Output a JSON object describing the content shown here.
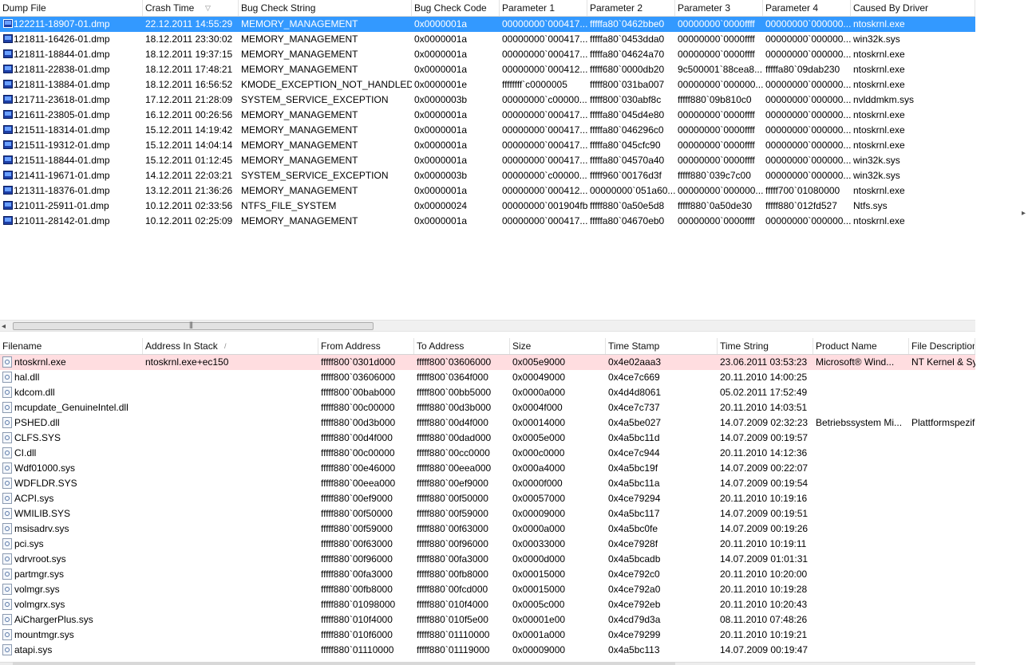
{
  "crash_list": {
    "columns": [
      "Dump File",
      "Crash Time",
      "Bug Check String",
      "Bug Check Code",
      "Parameter 1",
      "Parameter 2",
      "Parameter 3",
      "Parameter 4",
      "Caused By Driver"
    ],
    "sort_indicator": "▽",
    "rows": [
      [
        "122211-18907-01.dmp",
        "22.12.2011 14:55:29",
        "MEMORY_MANAGEMENT",
        "0x0000001a",
        "00000000`000417...",
        "fffffa80`0462bbe0",
        "00000000`0000ffff",
        "00000000`000000...",
        "ntoskrnl.exe"
      ],
      [
        "121811-16426-01.dmp",
        "18.12.2011 23:30:02",
        "MEMORY_MANAGEMENT",
        "0x0000001a",
        "00000000`000417...",
        "fffffa80`0453dda0",
        "00000000`0000ffff",
        "00000000`000000...",
        "win32k.sys"
      ],
      [
        "121811-18844-01.dmp",
        "18.12.2011 19:37:15",
        "MEMORY_MANAGEMENT",
        "0x0000001a",
        "00000000`000417...",
        "fffffa80`04624a70",
        "00000000`0000ffff",
        "00000000`000000...",
        "ntoskrnl.exe"
      ],
      [
        "121811-22838-01.dmp",
        "18.12.2011 17:48:21",
        "MEMORY_MANAGEMENT",
        "0x0000001a",
        "00000000`000412...",
        "fffff680`0000db20",
        "9c500001`88cea8...",
        "fffffa80`09dab230",
        "ntoskrnl.exe"
      ],
      [
        "121811-13884-01.dmp",
        "18.12.2011 16:56:52",
        "KMODE_EXCEPTION_NOT_HANDLED",
        "0x0000001e",
        "ffffffff`c0000005",
        "fffff800`031ba007",
        "00000000`000000...",
        "00000000`000000...",
        "ntoskrnl.exe"
      ],
      [
        "121711-23618-01.dmp",
        "17.12.2011 21:28:09",
        "SYSTEM_SERVICE_EXCEPTION",
        "0x0000003b",
        "00000000`c00000...",
        "fffff800`030abf8c",
        "fffff880`09b810c0",
        "00000000`000000...",
        "nvlddmkm.sys"
      ],
      [
        "121611-23805-01.dmp",
        "16.12.2011 00:26:56",
        "MEMORY_MANAGEMENT",
        "0x0000001a",
        "00000000`000417...",
        "fffffa80`045d4e80",
        "00000000`0000ffff",
        "00000000`000000...",
        "ntoskrnl.exe"
      ],
      [
        "121511-18314-01.dmp",
        "15.12.2011 14:19:42",
        "MEMORY_MANAGEMENT",
        "0x0000001a",
        "00000000`000417...",
        "fffffa80`046296c0",
        "00000000`0000ffff",
        "00000000`000000...",
        "ntoskrnl.exe"
      ],
      [
        "121511-19312-01.dmp",
        "15.12.2011 14:04:14",
        "MEMORY_MANAGEMENT",
        "0x0000001a",
        "00000000`000417...",
        "fffffa80`045cfc90",
        "00000000`0000ffff",
        "00000000`000000...",
        "ntoskrnl.exe"
      ],
      [
        "121511-18844-01.dmp",
        "15.12.2011 01:12:45",
        "MEMORY_MANAGEMENT",
        "0x0000001a",
        "00000000`000417...",
        "fffffa80`04570a40",
        "00000000`0000ffff",
        "00000000`000000...",
        "win32k.sys"
      ],
      [
        "121411-19671-01.dmp",
        "14.12.2011 22:03:21",
        "SYSTEM_SERVICE_EXCEPTION",
        "0x0000003b",
        "00000000`c00000...",
        "fffff960`00176d3f",
        "fffff880`039c7c00",
        "00000000`000000...",
        "win32k.sys"
      ],
      [
        "121311-18376-01.dmp",
        "13.12.2011 21:36:26",
        "MEMORY_MANAGEMENT",
        "0x0000001a",
        "00000000`000412...",
        "00000000`051a60...",
        "00000000`000000...",
        "fffff700`01080000",
        "ntoskrnl.exe"
      ],
      [
        "121011-25911-01.dmp",
        "10.12.2011 02:33:56",
        "NTFS_FILE_SYSTEM",
        "0x00000024",
        "00000000`001904fb",
        "fffff880`0a50e5d8",
        "fffff880`0a50de30",
        "fffff880`012fd527",
        "Ntfs.sys"
      ],
      [
        "121011-28142-01.dmp",
        "10.12.2011 02:25:09",
        "MEMORY_MANAGEMENT",
        "0x0000001a",
        "00000000`000417...",
        "fffffa80`04670eb0",
        "00000000`0000ffff",
        "00000000`000000...",
        "ntoskrnl.exe"
      ]
    ]
  },
  "module_list": {
    "columns": [
      "Filename",
      "Address In Stack",
      "From Address",
      "To Address",
      "Size",
      "Time Stamp",
      "Time String",
      "Product Name",
      "File Description"
    ],
    "sort_indicator": "/",
    "rows": [
      [
        "ntoskrnl.exe",
        "ntoskrnl.exe+ec150",
        "fffff800`0301d000",
        "fffff800`03606000",
        "0x005e9000",
        "0x4e02aaa3",
        "23.06.2011 03:53:23",
        "Microsoft® Wind...",
        "NT Kernel & System"
      ],
      [
        "hal.dll",
        "",
        "fffff800`03606000",
        "fffff800`0364f000",
        "0x00049000",
        "0x4ce7c669",
        "20.11.2010 14:00:25",
        "",
        ""
      ],
      [
        "kdcom.dll",
        "",
        "fffff800`00bab000",
        "fffff800`00bb5000",
        "0x0000a000",
        "0x4d4d8061",
        "05.02.2011 17:52:49",
        "",
        ""
      ],
      [
        "mcupdate_GenuineIntel.dll",
        "",
        "fffff880`00c00000",
        "fffff880`00d3b000",
        "0x0004f000",
        "0x4ce7c737",
        "20.11.2010 14:03:51",
        "",
        ""
      ],
      [
        "PSHED.dll",
        "",
        "fffff880`00d3b000",
        "fffff880`00d4f000",
        "0x00014000",
        "0x4a5be027",
        "14.07.2009 02:32:23",
        "Betriebssystem Mi...",
        "Plattformspezifischer"
      ],
      [
        "CLFS.SYS",
        "",
        "fffff880`00d4f000",
        "fffff880`00dad000",
        "0x0005e000",
        "0x4a5bc11d",
        "14.07.2009 00:19:57",
        "",
        ""
      ],
      [
        "CI.dll",
        "",
        "fffff880`00c00000",
        "fffff880`00cc0000",
        "0x000c0000",
        "0x4ce7c944",
        "20.11.2010 14:12:36",
        "",
        ""
      ],
      [
        "Wdf01000.sys",
        "",
        "fffff880`00e46000",
        "fffff880`00eea000",
        "0x000a4000",
        "0x4a5bc19f",
        "14.07.2009 00:22:07",
        "",
        ""
      ],
      [
        "WDFLDR.SYS",
        "",
        "fffff880`00eea000",
        "fffff880`00ef9000",
        "0x0000f000",
        "0x4a5bc11a",
        "14.07.2009 00:19:54",
        "",
        ""
      ],
      [
        "ACPI.sys",
        "",
        "fffff880`00ef9000",
        "fffff880`00f50000",
        "0x00057000",
        "0x4ce79294",
        "20.11.2010 10:19:16",
        "",
        ""
      ],
      [
        "WMILIB.SYS",
        "",
        "fffff880`00f50000",
        "fffff880`00f59000",
        "0x00009000",
        "0x4a5bc117",
        "14.07.2009 00:19:51",
        "",
        ""
      ],
      [
        "msisadrv.sys",
        "",
        "fffff880`00f59000",
        "fffff880`00f63000",
        "0x0000a000",
        "0x4a5bc0fe",
        "14.07.2009 00:19:26",
        "",
        ""
      ],
      [
        "pci.sys",
        "",
        "fffff880`00f63000",
        "fffff880`00f96000",
        "0x00033000",
        "0x4ce7928f",
        "20.11.2010 10:19:11",
        "",
        ""
      ],
      [
        "vdrvroot.sys",
        "",
        "fffff880`00f96000",
        "fffff880`00fa3000",
        "0x0000d000",
        "0x4a5bcadb",
        "14.07.2009 01:01:31",
        "",
        ""
      ],
      [
        "partmgr.sys",
        "",
        "fffff880`00fa3000",
        "fffff880`00fb8000",
        "0x00015000",
        "0x4ce792c0",
        "20.11.2010 10:20:00",
        "",
        ""
      ],
      [
        "volmgr.sys",
        "",
        "fffff880`00fb8000",
        "fffff880`00fcd000",
        "0x00015000",
        "0x4ce792a0",
        "20.11.2010 10:19:28",
        "",
        ""
      ],
      [
        "volmgrx.sys",
        "",
        "fffff880`01098000",
        "fffff880`010f4000",
        "0x0005c000",
        "0x4ce792eb",
        "20.11.2010 10:20:43",
        "",
        ""
      ],
      [
        "AiChargerPlus.sys",
        "",
        "fffff880`010f4000",
        "fffff880`010f5e00",
        "0x00001e00",
        "0x4cd79d3a",
        "08.11.2010 07:48:26",
        "",
        ""
      ],
      [
        "mountmgr.sys",
        "",
        "fffff880`010f6000",
        "fffff880`01110000",
        "0x0001a000",
        "0x4ce79299",
        "20.11.2010 10:19:21",
        "",
        ""
      ],
      [
        "atapi.sys",
        "",
        "fffff880`01110000",
        "fffff880`01119000",
        "0x00009000",
        "0x4a5bc113",
        "14.07.2009 00:19:47",
        "",
        ""
      ]
    ]
  },
  "scrollbar": {
    "left_arrow": "◂",
    "grip": "|||"
  },
  "right_edge_arrow": "▸",
  "colors": {
    "selection": "#3399ff",
    "highlight_row": "#ffdde0"
  },
  "icons": {
    "dump_file": "dump-file-icon",
    "module_file": "module-file-icon"
  }
}
